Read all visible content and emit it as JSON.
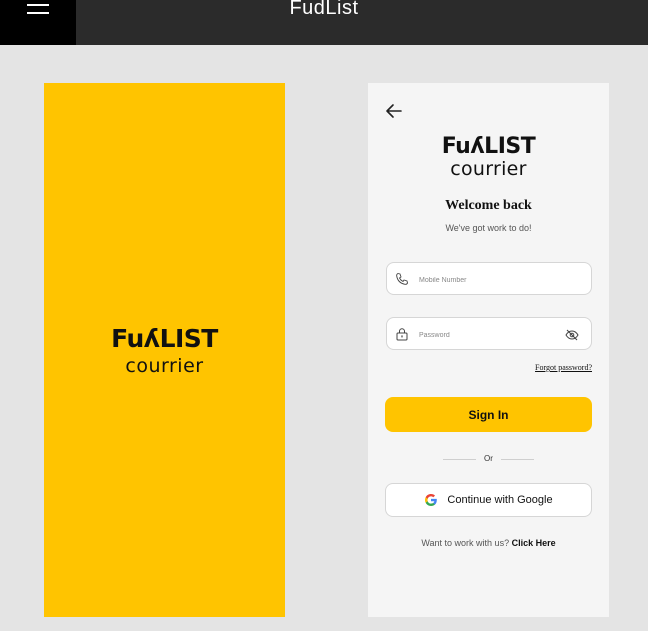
{
  "app": {
    "title": "FudList"
  },
  "splash": {
    "logo_brand": "FuʎLIST",
    "logo_sub": "courrier",
    "background": "#ffc400"
  },
  "login": {
    "logo_brand": "FuʎLIST",
    "logo_sub": "courrier",
    "welcome_title": "Welcome back",
    "welcome_subtitle": "We've got work to do!",
    "mobile_placeholder": "Mobile Number",
    "password_placeholder": "Password",
    "forgot_password": "Forgot password?",
    "signin_label": "Sign In",
    "or_label": "Or",
    "google_label": "Continue with Google",
    "work_prompt": "Want to work with us?",
    "work_link": "Click Here"
  },
  "icons": {
    "menu": "hamburger-icon",
    "back": "arrow-left-icon",
    "phone": "phone-icon",
    "lock": "lock-icon",
    "eye": "eye-off-icon",
    "google": "google-icon"
  },
  "colors": {
    "accent": "#ffc400",
    "topbar": "#2b2b2b"
  }
}
